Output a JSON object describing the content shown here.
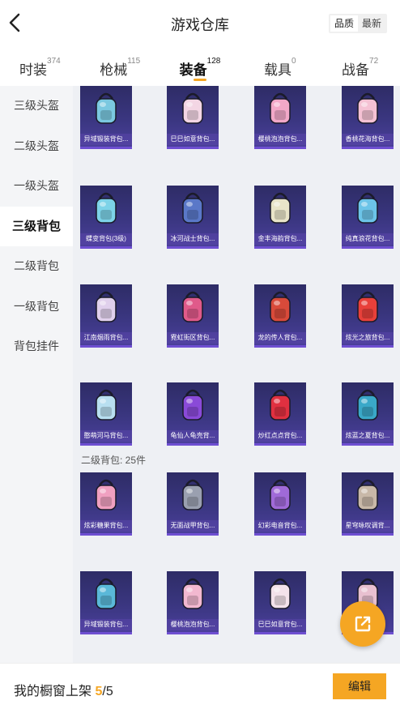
{
  "header": {
    "title": "游戏仓库",
    "sort_options": [
      "品质",
      "最新"
    ],
    "active_sort": 0
  },
  "tabs": [
    {
      "label": "时装",
      "count": "374"
    },
    {
      "label": "枪械",
      "count": "115"
    },
    {
      "label": "装备",
      "count": "128",
      "active": true
    },
    {
      "label": "载具",
      "count": "0"
    },
    {
      "label": "战备",
      "count": "72"
    }
  ],
  "sidebar": {
    "items": [
      {
        "label": "三级头盔"
      },
      {
        "label": "二级头盔"
      },
      {
        "label": "一级头盔"
      },
      {
        "label": "三级背包",
        "active": true
      },
      {
        "label": "二级背包"
      },
      {
        "label": "一级背包"
      },
      {
        "label": "背包挂件"
      }
    ]
  },
  "grid": {
    "section_label": "二级背包: 25件",
    "items": [
      {
        "name": "异域锻装背包...",
        "color": "#7bc8e0",
        "icon": "backpack-icon"
      },
      {
        "name": "巳巳如意背包...",
        "color": "#f3d6e4",
        "icon": "backpack-icon"
      },
      {
        "name": "樱桃泡泡背包...",
        "color": "#f2a8c8",
        "icon": "backpack-icon"
      },
      {
        "name": "香桃花海背包...",
        "color": "#f5c2d4",
        "icon": "backpack-icon"
      },
      {
        "name": "蝶变背包(3级)",
        "color": "#7dd3e8",
        "icon": "backpack-icon"
      },
      {
        "name": "冰河战士背包...",
        "color": "#5a78c8",
        "icon": "backpack-icon"
      },
      {
        "name": "金丰海韵背包...",
        "color": "#e8e4c8",
        "icon": "backpack-icon"
      },
      {
        "name": "纯真浪花背包...",
        "color": "#6cc4e8",
        "icon": "backpack-icon"
      },
      {
        "name": "江南烟雨背包...",
        "color": "#e0d0ec",
        "icon": "backpack-icon"
      },
      {
        "name": "霓虹街区背包...",
        "color": "#e05a8a",
        "icon": "backpack-icon"
      },
      {
        "name": "龙的传人背包...",
        "color": "#d84a3a",
        "icon": "backpack-icon"
      },
      {
        "name": "炫光之旅背包...",
        "color": "#e8403a",
        "icon": "backpack-icon"
      },
      {
        "name": "憨萌河马背包...",
        "color": "#b8dff0",
        "icon": "backpack-icon"
      },
      {
        "name": "龟仙人龟壳背...",
        "color": "#8a4ad8",
        "icon": "backpack-icon"
      },
      {
        "name": "炒红点点背包...",
        "color": "#e03040",
        "icon": "backpack-icon"
      },
      {
        "name": "炫蓝之夏背包...",
        "color": "#3aa8c8",
        "icon": "backpack-icon"
      },
      {
        "name": "炫彩糖果背包...",
        "color": "#f0a0c0",
        "icon": "backpack-icon"
      },
      {
        "name": "无面战甲背包...",
        "color": "#9aa0b0",
        "icon": "backpack-icon"
      },
      {
        "name": "幻彩电音背包...",
        "color": "#a06ad8",
        "icon": "backpack-icon"
      },
      {
        "name": "星穹咏叹调背...",
        "color": "#c8b8a8",
        "icon": "backpack-icon"
      },
      {
        "name": "异域锻装背包...",
        "color": "#5ab8d8",
        "icon": "backpack-icon"
      },
      {
        "name": "樱桃泡泡背包...",
        "color": "#f2b8d0",
        "icon": "backpack-icon"
      },
      {
        "name": "巳巳如意背包...",
        "color": "#f3e2ea",
        "icon": "backpack-icon"
      },
      {
        "name": "",
        "color": "#e8c0d0",
        "icon": "backpack-icon"
      }
    ]
  },
  "footer": {
    "showcase_label": "我的橱窗上架",
    "showcase_current": "5",
    "showcase_sep": "/",
    "showcase_total": "5",
    "edit_label": "编辑"
  },
  "fab": {
    "icon": "external-link-icon"
  }
}
